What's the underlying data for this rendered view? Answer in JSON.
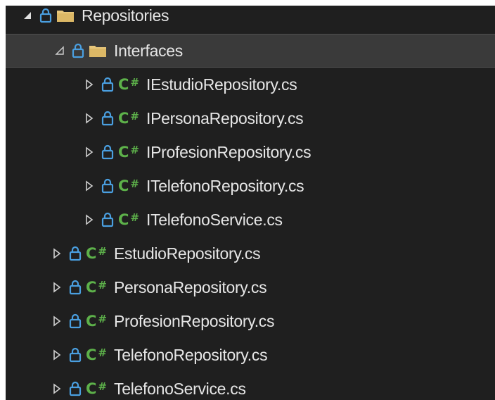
{
  "tree": {
    "root": {
      "label": "Repositories",
      "expanded": true,
      "icon": "folder-icon"
    },
    "interfaces": {
      "label": "Interfaces",
      "expanded": true,
      "selected": true,
      "icon": "folder-icon"
    },
    "interface_files": [
      {
        "label": "IEstudioRepository.cs",
        "icon": "csharp-file-icon"
      },
      {
        "label": "IPersonaRepository.cs",
        "icon": "csharp-file-icon"
      },
      {
        "label": "IProfesionRepository.cs",
        "icon": "csharp-file-icon"
      },
      {
        "label": "ITelefonoRepository.cs",
        "icon": "csharp-file-icon"
      },
      {
        "label": "ITelefonoService.cs",
        "icon": "csharp-file-icon"
      }
    ],
    "files": [
      {
        "label": "EstudioRepository.cs",
        "icon": "csharp-file-icon"
      },
      {
        "label": "PersonaRepository.cs",
        "icon": "csharp-file-icon"
      },
      {
        "label": "ProfesionRepository.cs",
        "icon": "csharp-file-icon"
      },
      {
        "label": "TelefonoRepository.cs",
        "icon": "csharp-file-icon"
      },
      {
        "label": "TelefonoService.cs",
        "icon": "csharp-file-icon"
      }
    ],
    "csharp_badge": "C",
    "csharp_hash": "#"
  },
  "colors": {
    "background": "#1f1f1f",
    "selected_row": "#3a3a3a",
    "text": "#e6e6e6",
    "lock": "#4a9fe0",
    "folder": "#e8c77b",
    "csharp": "#5db14a",
    "expander": "#cfcfcf"
  }
}
